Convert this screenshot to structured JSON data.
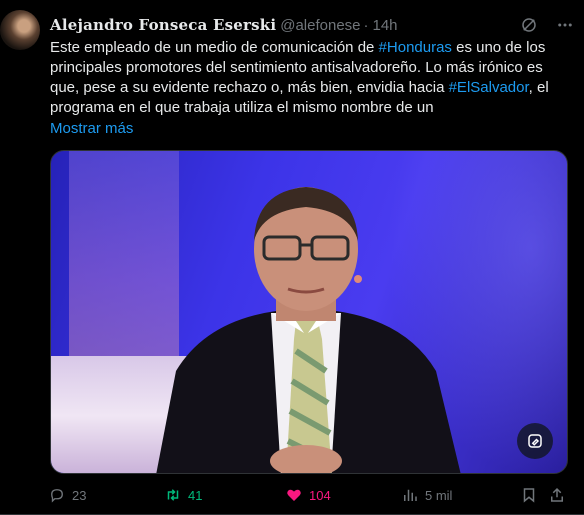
{
  "tweet": {
    "author_name": "Alejandro Fonseca Eserski",
    "handle": "@alefonese",
    "separator": "·",
    "time": "14h",
    "text_part1": "Este empleado de un medio de comunicación de ",
    "hashtag1": "#Honduras",
    "text_part2": " es uno de los principales promotores del sentimiento antisalvadoreño. Lo más irónico es que, pese a su evidente rechazo o, más bien, envidia hacia ",
    "hashtag2": "#ElSalvador",
    "text_part3": ", el programa en el que trabaja utiliza el mismo nombre de un",
    "show_more": "Mostrar más"
  },
  "actions": {
    "replies": "23",
    "reposts": "41",
    "likes": "104",
    "views": "5 mil"
  },
  "colors": {
    "link": "#1d9bf0",
    "repost": "#00ba7c",
    "like": "#f91880",
    "muted": "#71767b"
  }
}
